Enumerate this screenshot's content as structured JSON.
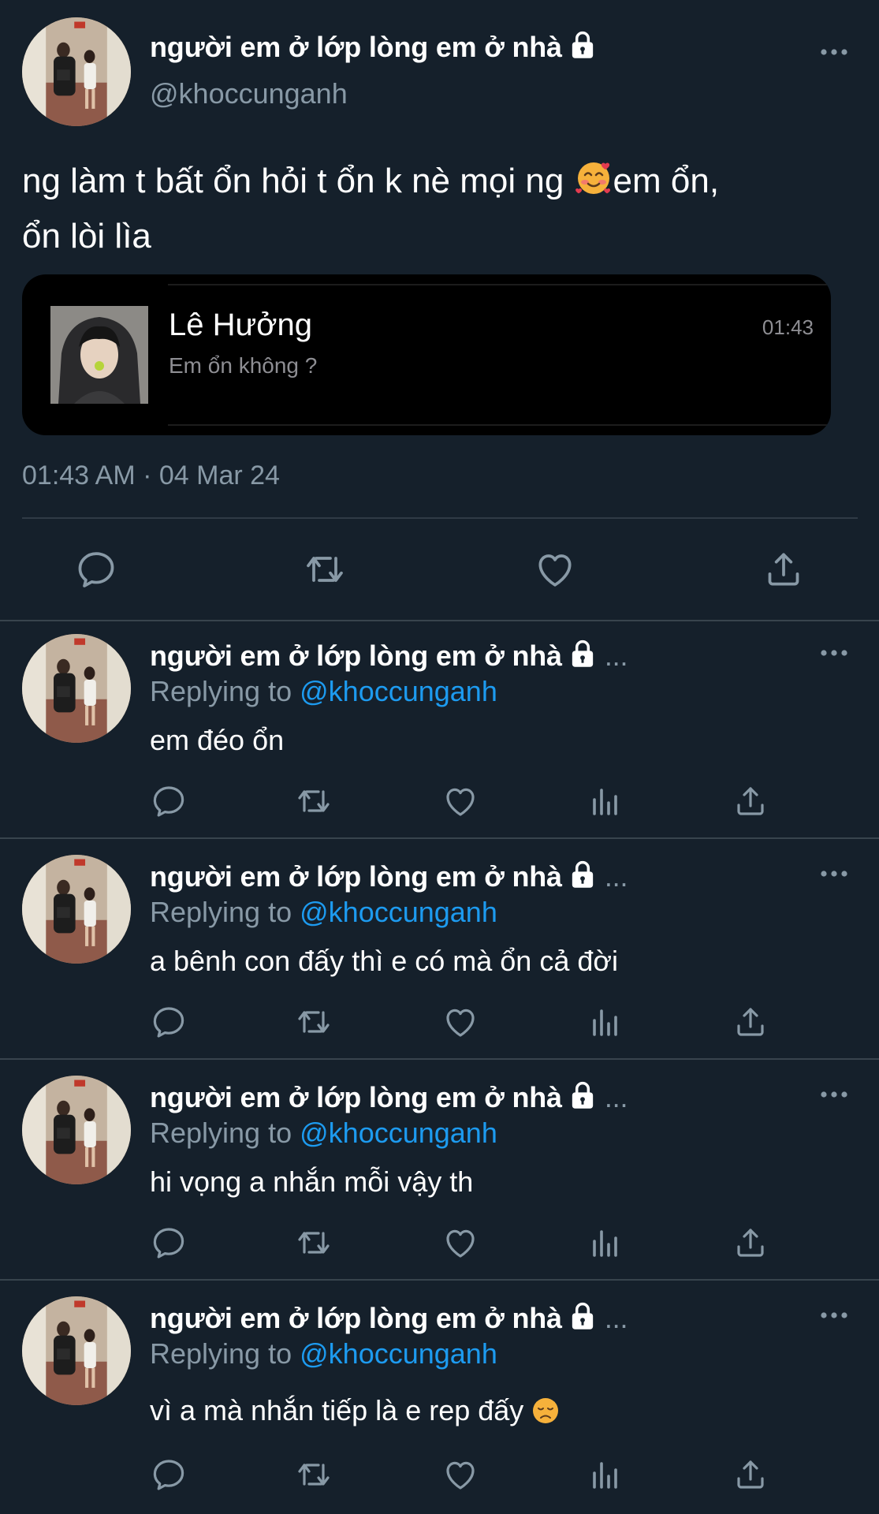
{
  "main_tweet": {
    "display_name": "người em ở lớp lòng em ở nhà",
    "handle": "@khoccunganh",
    "text_line1_part1": "ng làm t bất ổn hỏi t ổn k nè mọi ng",
    "text_line1_part2": "em ổn,",
    "text_line2": "ổn lòi lìa",
    "media": {
      "contact_name": "Lê Hưởng",
      "message": "Em ổn không ?",
      "time": "01:43"
    },
    "timestamp": "01:43 AM · 04 Mar 24"
  },
  "replies": [
    {
      "display_name": "người em ở lớp lòng em ở nhà",
      "ellipsis": "...",
      "replying_prefix": "Replying to",
      "replying_to": "@khoccunganh",
      "text": "em đéo ổn"
    },
    {
      "display_name": "người em ở lớp lòng em ở nhà",
      "ellipsis": "...",
      "replying_prefix": "Replying to",
      "replying_to": "@khoccunganh",
      "text": "a bênh con đấy thì e có mà ổn cả đời"
    },
    {
      "display_name": "người em ở lớp lòng em ở nhà",
      "ellipsis": "...",
      "replying_prefix": "Replying to",
      "replying_to": "@khoccunganh",
      "text": "hi vọng a nhắn mỗi vậy th"
    },
    {
      "display_name": "người em ở lớp lòng em ở nhà",
      "ellipsis": "...",
      "replying_prefix": "Replying to",
      "replying_to": "@khoccunganh",
      "text": "vì a mà nhắn tiếp là e rep đấy"
    }
  ],
  "icons": {
    "reply": "reply-icon",
    "retweet": "retweet-icon",
    "like": "like-icon",
    "analytics": "analytics-icon",
    "share": "share-icon",
    "more": "more-icon",
    "lock": "lock-icon"
  },
  "colors": {
    "background": "#15202b",
    "muted": "#8899a6",
    "accent": "#1d9bf0",
    "divider": "#38444d"
  }
}
